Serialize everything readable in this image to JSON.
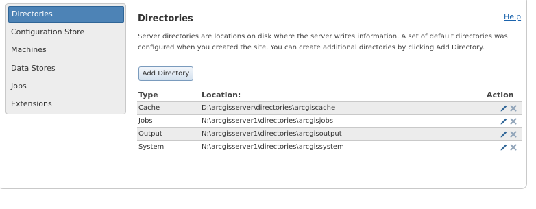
{
  "sidebar": {
    "items": [
      {
        "label": "Directories",
        "active": true
      },
      {
        "label": "Configuration Store",
        "active": false
      },
      {
        "label": "Machines",
        "active": false
      },
      {
        "label": "Data Stores",
        "active": false
      },
      {
        "label": "Jobs",
        "active": false
      },
      {
        "label": "Extensions",
        "active": false
      }
    ]
  },
  "header": {
    "title": "Directories",
    "help_label": "Help"
  },
  "description": "Server directories are locations on disk where the server writes information. A set of default directories was configured when you created the site. You can create additional directories by clicking Add Directory.",
  "toolbar": {
    "add_label": "Add Directory"
  },
  "table": {
    "columns": [
      "Type",
      "Location:",
      "Action"
    ],
    "rows": [
      {
        "type": "Cache",
        "location": "D:\\arcgisserver\\directories\\arcgiscache",
        "actions": [
          "edit-icon",
          "delete-icon"
        ]
      },
      {
        "type": "Jobs",
        "location": "N:\\arcgisserver1\\directories\\arcgisjobs",
        "actions": [
          "edit-icon",
          "delete-icon"
        ]
      },
      {
        "type": "Output",
        "location": "N:\\arcgisserver1\\directories\\arcgisoutput",
        "actions": [
          "edit-icon",
          "delete-icon"
        ]
      },
      {
        "type": "System",
        "location": "N:\\arcgisserver1\\directories\\arcgissystem",
        "actions": [
          "edit-icon",
          "delete-icon"
        ]
      }
    ]
  },
  "colors": {
    "accent": "#4d83b6",
    "link": "#1c64ad",
    "edit_icon": "#2f6597",
    "delete_icon": "#8fa3b8"
  }
}
